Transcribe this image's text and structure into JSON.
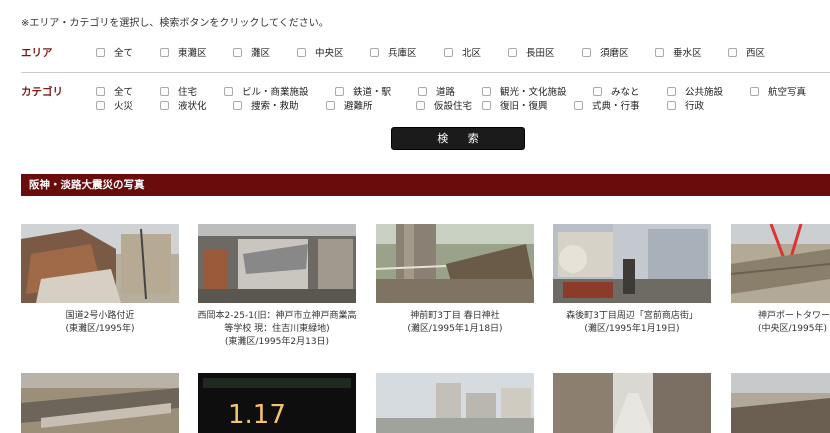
{
  "instruction": "※エリア・カテゴリを選択し、検索ボタンをクリックしてください。",
  "area": {
    "label": "エリア",
    "options": [
      "全て",
      "東灘区",
      "灘区",
      "中央区",
      "兵庫区",
      "北区",
      "長田区",
      "須磨区",
      "垂水区",
      "西区"
    ]
  },
  "category": {
    "label": "カテゴリ",
    "row1": [
      "全て",
      "住宅",
      "ビル・商業施設",
      "鉄道・駅",
      "道路",
      "観光・文化施設",
      "みなと",
      "公共施設",
      "航空写真"
    ],
    "row2": [
      "火災",
      "液状化",
      "捜索・救助",
      "避難所",
      "仮設住宅",
      "復旧・復興",
      "式典・行事",
      "行政"
    ]
  },
  "search_button": "検 索",
  "section_title": "阪神・淡路大震災の写真",
  "photos": [
    {
      "line1": "国道2号小路付近",
      "line2": "(東灘区/1995年)",
      "line3": ""
    },
    {
      "line1": "西岡本2-25-1(旧：神戸市立神戸商業高",
      "line2": "等学校 現：住吉川東緑地)",
      "line3": "(東灘区/1995年2月13日)"
    },
    {
      "line1": "神前町3丁目 春日神社",
      "line2": "(灘区/1995年1月18日)",
      "line3": ""
    },
    {
      "line1": "森後町3丁目周辺「宮前商店街」",
      "line2": "(灘区/1995年1月19日)",
      "line3": ""
    },
    {
      "line1": "神戸ポートタワー付近",
      "line2": "(中央区/1995年)",
      "line3": ""
    }
  ]
}
